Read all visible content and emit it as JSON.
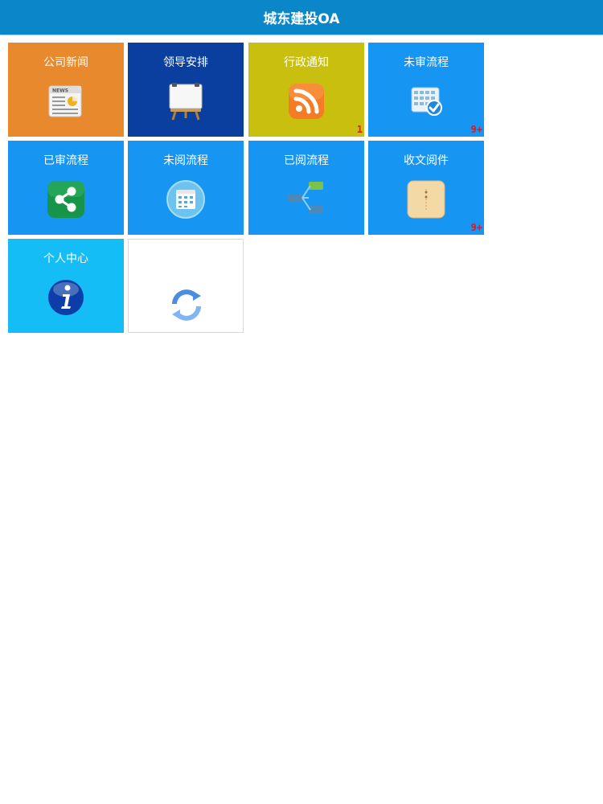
{
  "header": {
    "title": "城东建投OA"
  },
  "tiles": [
    {
      "label": "公司新闻",
      "color": "#e9892d",
      "icon": "newspaper-icon",
      "badge": ""
    },
    {
      "label": "领导安排",
      "color": "#0a3fa0",
      "icon": "easel-board-icon",
      "badge": ""
    },
    {
      "label": "行政通知",
      "color": "#c8bf0e",
      "icon": "rss-feed-icon",
      "badge": "1"
    },
    {
      "label": "未审流程",
      "color": "#1695f2",
      "icon": "calendar-check-icon",
      "badge": "9+"
    },
    {
      "label": "已审流程",
      "color": "#1695f2",
      "icon": "share-icon",
      "badge": ""
    },
    {
      "label": "未阅流程",
      "color": "#1695f2",
      "icon": "calendar-icon",
      "badge": ""
    },
    {
      "label": "已阅流程",
      "color": "#1695f2",
      "icon": "flowchart-icon",
      "badge": ""
    },
    {
      "label": "收文阅件",
      "color": "#1695f2",
      "icon": "envelope-icon",
      "badge": "9+"
    },
    {
      "label": "个人中心",
      "color": "#14bdf6",
      "icon": "info-icon",
      "badge": ""
    },
    {
      "label": "",
      "color": "#ffffff",
      "icon": "refresh-icon",
      "badge": ""
    }
  ]
}
